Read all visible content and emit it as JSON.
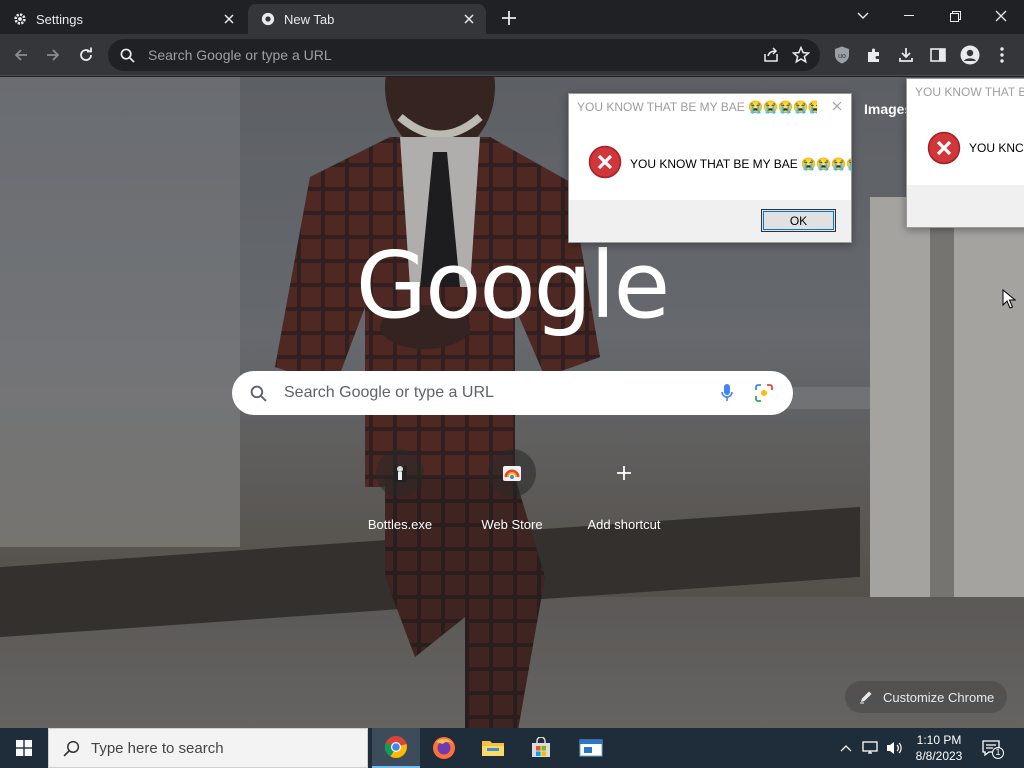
{
  "tabs": [
    {
      "title": "Settings",
      "icon": "gear-icon"
    },
    {
      "title": "New Tab",
      "icon": "chrome-icon"
    }
  ],
  "omnibox": {
    "placeholder": "Search Google or type a URL"
  },
  "page": {
    "logo": "Google",
    "images_link": "Images",
    "search_placeholder": "Search Google or type a URL",
    "shortcuts": [
      {
        "label": "Bottles.exe"
      },
      {
        "label": "Web Store"
      },
      {
        "label": "Add shortcut"
      }
    ],
    "customize_label": "Customize Chrome"
  },
  "dialogs": [
    {
      "title": "YOU KNOW THAT BE MY BAE 😭😭😭😭😭😭⁉️...",
      "message": "YOU KNOW THAT BE MY BAE 😭😭😭😭",
      "ok_label": "OK"
    },
    {
      "title": "YOU KNOW THAT BE",
      "message": "YOU KNC"
    }
  ],
  "taskbar": {
    "search_placeholder": "Type here to search",
    "time": "1:10 PM",
    "date": "8/8/2023",
    "notification_count": "1"
  },
  "colors": {
    "tabstrip": "#202124",
    "toolbar": "#35363a",
    "taskbar": "#1f2d3a",
    "error_red": "#d0363a"
  }
}
